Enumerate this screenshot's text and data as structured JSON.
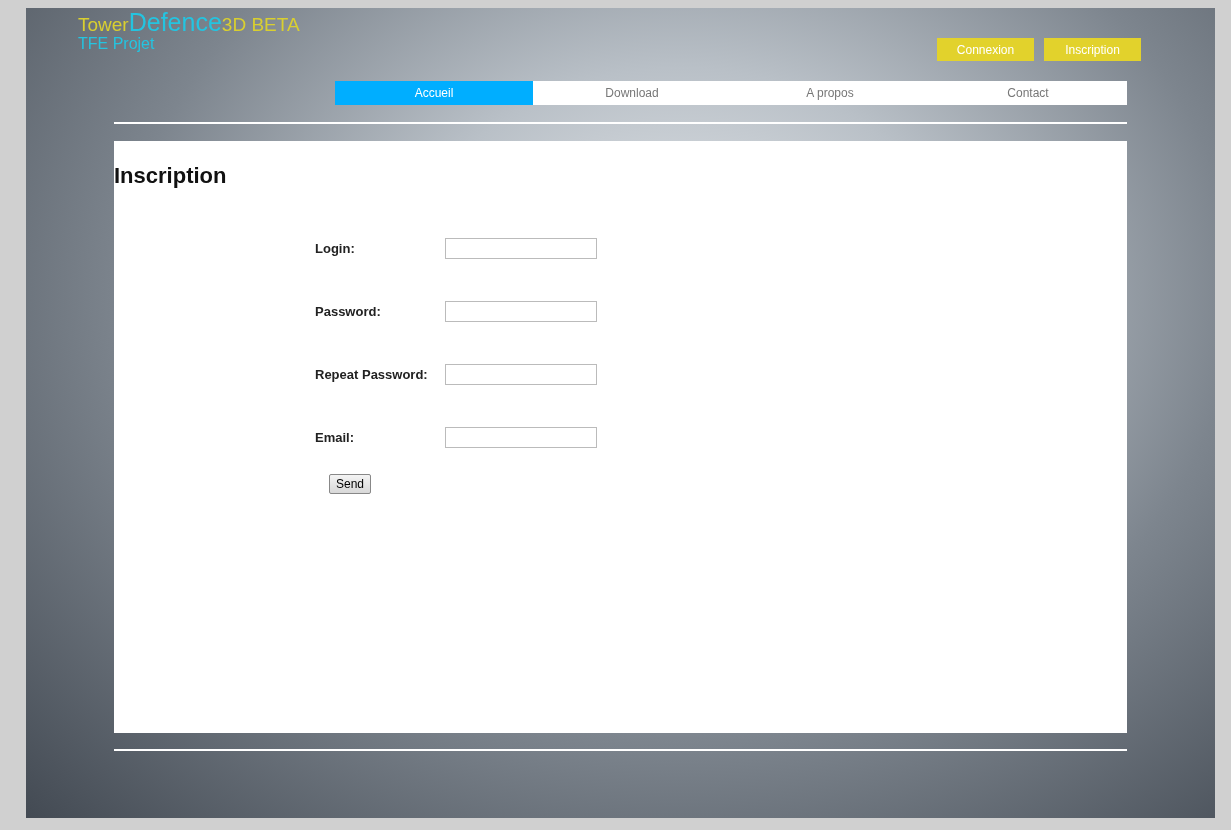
{
  "logo": {
    "title_parts": [
      {
        "text": "Tower",
        "kind": "plain"
      },
      {
        "text": "Defence",
        "kind": "accent"
      },
      {
        "text": "3D BETA",
        "kind": "plain"
      }
    ],
    "subtitle": "TFE Projet"
  },
  "account_buttons": [
    "Connexion",
    "Inscription"
  ],
  "nav": [
    {
      "label": "Accueil",
      "selected": true
    },
    {
      "label": "Download",
      "selected": false
    },
    {
      "label": "A propos",
      "selected": false
    },
    {
      "label": "Contact",
      "selected": false
    }
  ],
  "page_title": "Inscription",
  "form": {
    "fields": [
      {
        "label": "Login:"
      },
      {
        "label": "Password:"
      },
      {
        "label": "Repeat Password:"
      },
      {
        "label": "Email:"
      }
    ],
    "submit": "Send"
  }
}
